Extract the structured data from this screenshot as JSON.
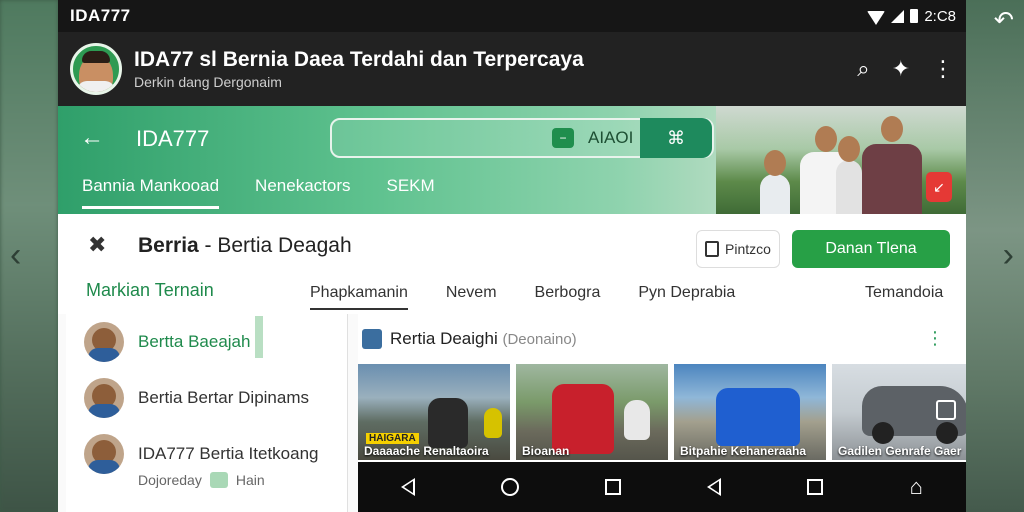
{
  "statusbar": {
    "carrier": "IDA777",
    "time": "2:C8"
  },
  "appbar": {
    "title": "IDA77 sl Bernia Daea Terdahi dan Terpercaya",
    "subtitle": "Derkin dang Dergonaim"
  },
  "hero": {
    "title": "IDA777",
    "tag_label": "AIAOI",
    "tabs": [
      "Bannia Mankooad",
      "Nenekactors",
      "SEKM"
    ]
  },
  "section": {
    "title_bold": "Berria",
    "title_rest": " - Bertia Deagah",
    "outline_button": "Pintzco",
    "primary_button": "Danan Tlena",
    "left_label": "Markian Ternain",
    "sub_tabs": [
      "Phapkamanin",
      "Nevem",
      "Berbogra",
      "Pyn Deprabia",
      "Temandoia"
    ]
  },
  "list": [
    {
      "text": "Bertta Baeajah"
    },
    {
      "text": "Bertia Bertar Dipinams"
    },
    {
      "text": "IDA777 Bertia Itetkoang",
      "meta": "Dojoreday",
      "meta2": "Hain"
    }
  ],
  "media": {
    "title": "Rertia Deaighi",
    "muted": "(Deonaino)",
    "thumbs": [
      {
        "caption": "Daaaache Renaltaoira",
        "label": "HAIGARA"
      },
      {
        "caption": "Bioanan"
      },
      {
        "caption": "Bitpahie Kehaneraaha"
      },
      {
        "caption": "Gadilen Genrafe Gaer"
      }
    ]
  }
}
